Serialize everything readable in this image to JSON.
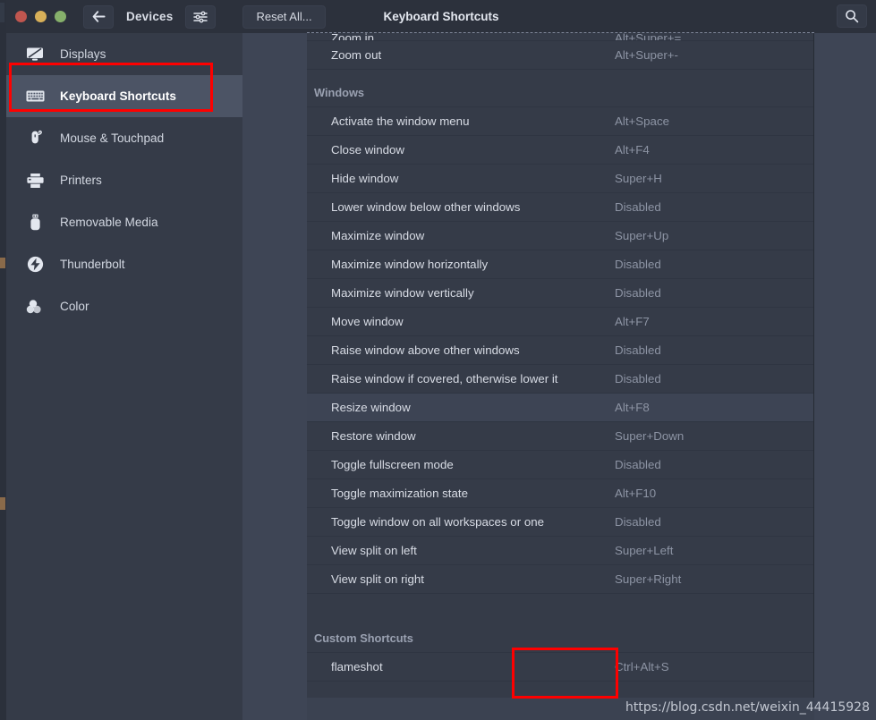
{
  "window": {
    "title": "Keyboard Shortcuts",
    "back_label": "back-arrow",
    "section_label": "Devices",
    "sliders_label": "sliders-icon",
    "reset_label": "Reset All...",
    "search_label": "search-icon",
    "traffic": {
      "close": "close",
      "minimize": "minimize",
      "maximize": "maximize"
    }
  },
  "sidebar": {
    "items": [
      {
        "label": "Displays",
        "icon": "display-icon",
        "active": false
      },
      {
        "label": "Keyboard Shortcuts",
        "icon": "keyboard-icon",
        "active": true
      },
      {
        "label": "Mouse & Touchpad",
        "icon": "mouse-icon",
        "active": false
      },
      {
        "label": "Printers",
        "icon": "printer-icon",
        "active": false
      },
      {
        "label": "Removable Media",
        "icon": "usb-icon",
        "active": false
      },
      {
        "label": "Thunderbolt",
        "icon": "thunderbolt-icon",
        "active": false
      },
      {
        "label": "Color",
        "icon": "color-icon",
        "active": false
      }
    ]
  },
  "shortcuts": {
    "top_clipped": {
      "name": "Zoom in",
      "accel": "Alt+Super+="
    },
    "rows_before_windows": [
      {
        "name": "Zoom out",
        "accel": "Alt+Super+-"
      }
    ],
    "sections": [
      {
        "title": "Windows",
        "rows": [
          {
            "name": "Activate the window menu",
            "accel": "Alt+Space",
            "hover": false
          },
          {
            "name": "Close window",
            "accel": "Alt+F4",
            "hover": false
          },
          {
            "name": "Hide window",
            "accel": "Super+H",
            "hover": false
          },
          {
            "name": "Lower window below other windows",
            "accel": "Disabled",
            "hover": false
          },
          {
            "name": "Maximize window",
            "accel": "Super+Up",
            "hover": false
          },
          {
            "name": "Maximize window horizontally",
            "accel": "Disabled",
            "hover": false
          },
          {
            "name": "Maximize window vertically",
            "accel": "Disabled",
            "hover": false
          },
          {
            "name": "Move window",
            "accel": "Alt+F7",
            "hover": false
          },
          {
            "name": "Raise window above other windows",
            "accel": "Disabled",
            "hover": false
          },
          {
            "name": "Raise window if covered, otherwise lower it",
            "accel": "Disabled",
            "hover": false
          },
          {
            "name": "Resize window",
            "accel": "Alt+F8",
            "hover": true
          },
          {
            "name": "Restore window",
            "accel": "Super+Down",
            "hover": false
          },
          {
            "name": "Toggle fullscreen mode",
            "accel": "Disabled",
            "hover": false
          },
          {
            "name": "Toggle maximization state",
            "accel": "Alt+F10",
            "hover": false
          },
          {
            "name": "Toggle window on all workspaces or one",
            "accel": "Disabled",
            "hover": false
          },
          {
            "name": "View split on left",
            "accel": "Super+Left",
            "hover": false
          },
          {
            "name": "View split on right",
            "accel": "Super+Right",
            "hover": false
          }
        ]
      },
      {
        "title": "Custom Shortcuts",
        "rows": [
          {
            "name": "flameshot",
            "accel": "Ctrl+Alt+S",
            "hover": false
          }
        ]
      }
    ],
    "add_label": "+"
  },
  "watermark": {
    "text": "https://blog.csdn.net/weixin_44415928"
  },
  "colors": {
    "window_bg": "#353b48",
    "titlebar_bg": "#2c313c",
    "panel_backdrop": "#3e4555",
    "selected_sidebar": "#4c5465",
    "hover_row": "#3d4454",
    "accent_red": "#fe0000",
    "text_primary": "#d8dce5",
    "text_muted": "#8d94a4"
  }
}
